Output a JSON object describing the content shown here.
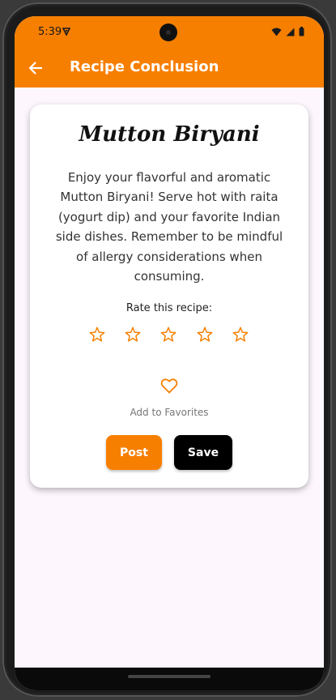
{
  "status_bar": {
    "time": "5:39",
    "icons": [
      "vpn-icon",
      "wifi-icon",
      "signal-icon",
      "battery-icon"
    ]
  },
  "app_bar": {
    "title": "Recipe Conclusion",
    "back_icon": "arrow-left-icon"
  },
  "recipe": {
    "title": "Mutton Biryani",
    "description": "Enjoy your flavorful and aromatic Mutton Biryani! Serve hot with raita (yogurt dip) and your favorite Indian side dishes. Remember to be mindful of allergy considerations when consuming."
  },
  "rating": {
    "label": "Rate this recipe:",
    "max_stars": 5,
    "current": 0,
    "star_icon": "star-outline-icon"
  },
  "favorites": {
    "icon": "heart-outline-icon",
    "label": "Add to Favorites"
  },
  "actions": {
    "post_label": "Post",
    "save_label": "Save"
  },
  "colors": {
    "accent": "#f77f00",
    "save_button": "#000000",
    "background": "#fdf6fd"
  }
}
